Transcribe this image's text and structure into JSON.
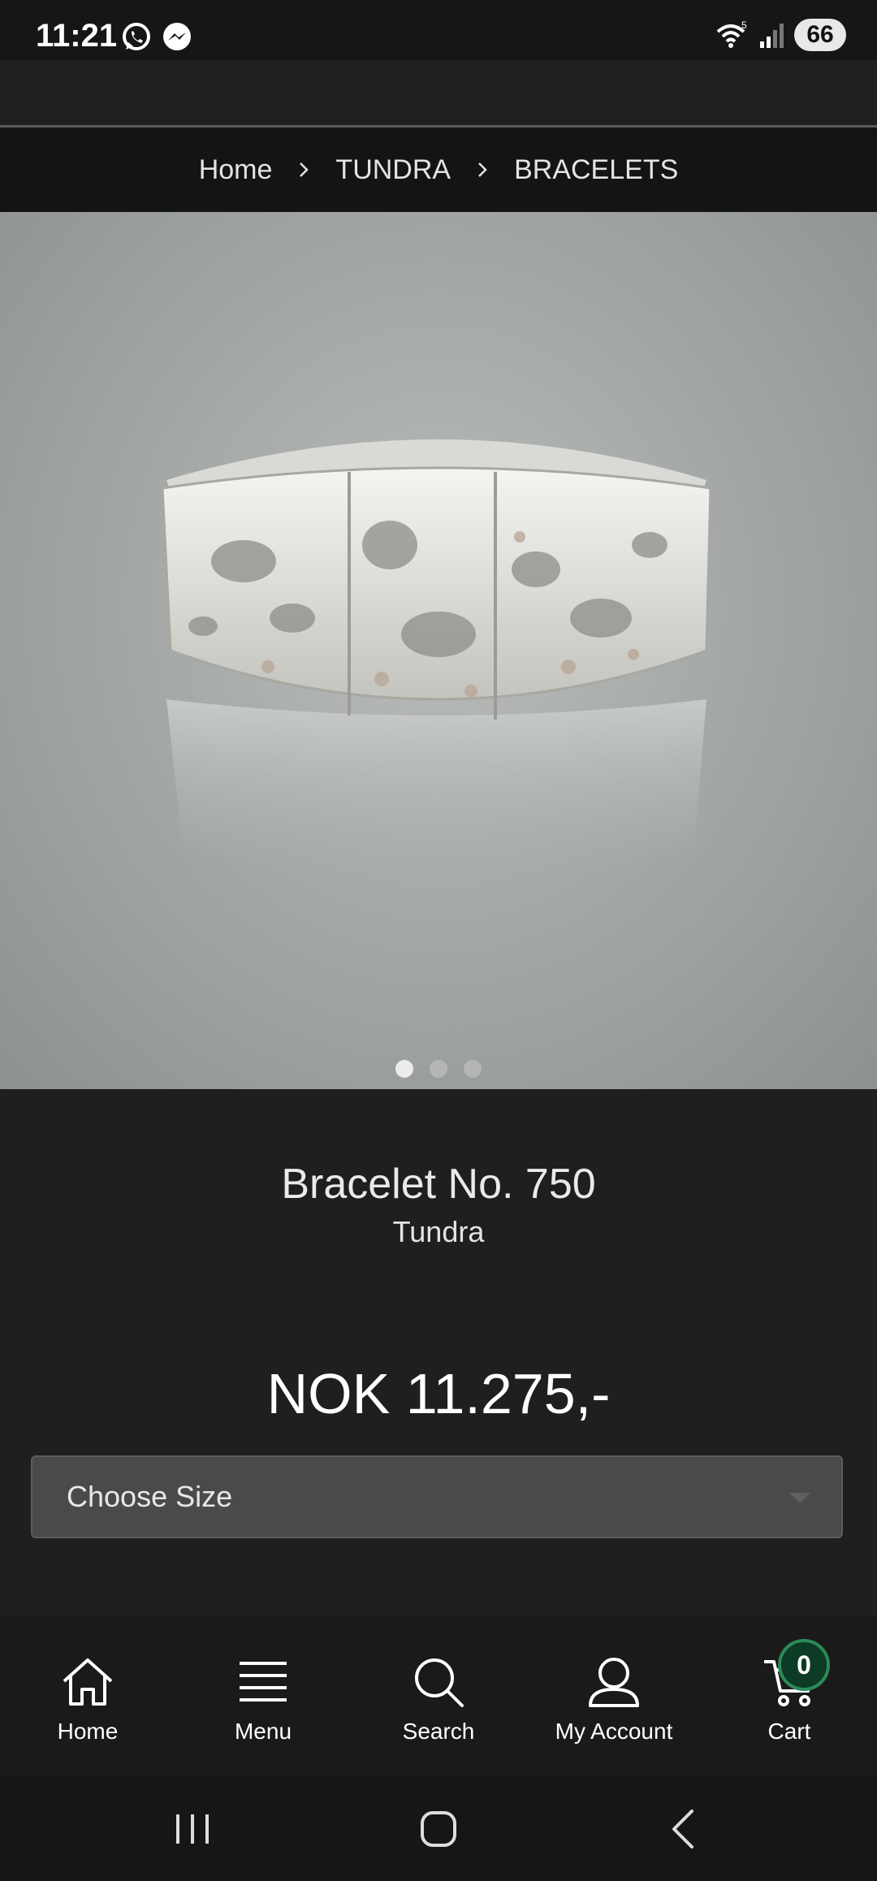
{
  "status_bar": {
    "time": "11:21",
    "battery": "66"
  },
  "breadcrumb": {
    "items": [
      "Home",
      "TUNDRA",
      "BRACELETS"
    ]
  },
  "gallery": {
    "slide_count": 3,
    "active_index": 0
  },
  "product": {
    "name": "Bracelet No. 750",
    "collection": "Tundra",
    "price": "NOK 11.275,-",
    "size_select": {
      "label": "Choose Size"
    }
  },
  "bottom_nav": {
    "items": [
      {
        "label": "Home",
        "icon": "home-icon"
      },
      {
        "label": "Menu",
        "icon": "menu-icon"
      },
      {
        "label": "Search",
        "icon": "search-icon"
      },
      {
        "label": "My Account",
        "icon": "account-icon"
      },
      {
        "label": "Cart",
        "icon": "cart-icon"
      }
    ],
    "cart_count": "0"
  },
  "colors": {
    "background": "#1f1f1f",
    "cart_badge": "#0d3b25",
    "cart_badge_border": "#2b8b58"
  }
}
